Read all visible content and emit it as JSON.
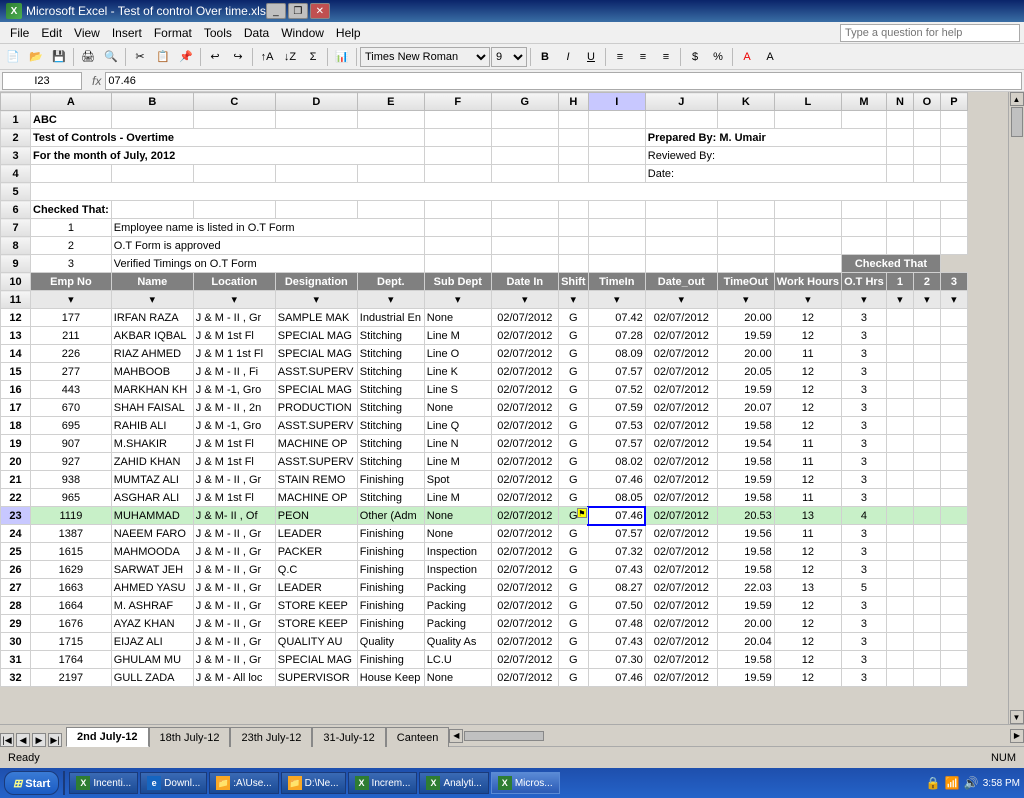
{
  "window": {
    "title": "Microsoft Excel - Test of control Over time.xls",
    "icon": "excel-icon"
  },
  "menubar": {
    "items": [
      "File",
      "Edit",
      "View",
      "Insert",
      "Format",
      "Tools",
      "Data",
      "Window",
      "Help"
    ]
  },
  "toolbar": {
    "font": "Times New Roman",
    "font_size": "9",
    "help_placeholder": "Type a question for help"
  },
  "formula_bar": {
    "name_box": "I23",
    "formula": "07.46"
  },
  "spreadsheet": {
    "title1": "ABC",
    "title2": "Test of Controls - Overtime",
    "title3": "For the month of July, 2012",
    "prepared": "Prepared By: M. Umair",
    "reviewed": "Reviewed By:",
    "date": "Date:",
    "checked_that": "Checked That:",
    "check1": "1",
    "check1_text": "Employee name is listed in O.T Form",
    "check2": "2",
    "check2_text": "O.T Form is approved",
    "check3": "3",
    "check3_text": "Verified Timings on O.T Form",
    "columns": [
      "Emp No",
      "Name",
      "Location",
      "Designation",
      "Dept.",
      "Sub Dept",
      "Date In",
      "Shift",
      "TimeIn",
      "Date_out",
      "TimeOut",
      "Work Hours",
      "O.T Hrs",
      "1",
      "2",
      "3"
    ],
    "checked_that_header": "Checked That",
    "rows": [
      [
        "177",
        "IRFAN RAZA",
        "J & M - II , Gr",
        "SAMPLE MAK",
        "Industrial En",
        "None",
        "02/07/2012",
        "G",
        "07.42",
        "02/07/2012",
        "20.00",
        "12",
        "3",
        "",
        "",
        ""
      ],
      [
        "211",
        "AKBAR IQBAL",
        "J & M 1st Fl",
        "SPECIAL MAG",
        "Stitching",
        "Line M",
        "02/07/2012",
        "G",
        "07.28",
        "02/07/2012",
        "19.59",
        "12",
        "3",
        "",
        "",
        ""
      ],
      [
        "226",
        "RIAZ AHMED",
        "J & M 1 1st Fl",
        "SPECIAL MAG",
        "Stitching",
        "Line O",
        "02/07/2012",
        "G",
        "08.09",
        "02/07/2012",
        "20.00",
        "11",
        "3",
        "",
        "",
        ""
      ],
      [
        "277",
        "MAHBOOB",
        "J & M - II , Fi",
        "ASST.SUPERV",
        "Stitching",
        "Line K",
        "02/07/2012",
        "G",
        "07.57",
        "02/07/2012",
        "20.05",
        "12",
        "3",
        "",
        "",
        ""
      ],
      [
        "443",
        "MARKHAN KH",
        "J & M -1, Gro",
        "SPECIAL MAG",
        "Stitching",
        "Line S",
        "02/07/2012",
        "G",
        "07.52",
        "02/07/2012",
        "19.59",
        "12",
        "3",
        "",
        "",
        ""
      ],
      [
        "670",
        "SHAH FAISAL",
        "J & M - II , 2n",
        "PRODUCTION",
        "Stitching",
        "None",
        "02/07/2012",
        "G",
        "07.59",
        "02/07/2012",
        "20.07",
        "12",
        "3",
        "",
        "",
        ""
      ],
      [
        "695",
        "RAHIB ALI",
        "J & M -1, Gro",
        "ASST.SUPERV",
        "Stitching",
        "Line Q",
        "02/07/2012",
        "G",
        "07.53",
        "02/07/2012",
        "19.58",
        "12",
        "3",
        "",
        "",
        ""
      ],
      [
        "907",
        "M.SHAKIR",
        "J & M 1st Fl",
        "MACHINE OP",
        "Stitching",
        "Line N",
        "02/07/2012",
        "G",
        "07.57",
        "02/07/2012",
        "19.54",
        "11",
        "3",
        "",
        "",
        ""
      ],
      [
        "927",
        "ZAHID KHAN",
        "J & M 1st Fl",
        "ASST.SUPERV",
        "Stitching",
        "Line M",
        "02/07/2012",
        "G",
        "08.02",
        "02/07/2012",
        "19.58",
        "11",
        "3",
        "",
        "",
        ""
      ],
      [
        "938",
        "MUMTAZ ALI",
        "J & M - II , Gr",
        "STAIN REMO",
        "Finishing",
        "Spot",
        "02/07/2012",
        "G",
        "07.46",
        "02/07/2012",
        "19.59",
        "12",
        "3",
        "",
        "",
        ""
      ],
      [
        "965",
        "ASGHAR ALI",
        "J & M 1st Fl",
        "MACHINE OP",
        "Stitching",
        "Line M",
        "02/07/2012",
        "G",
        "08.05",
        "02/07/2012",
        "19.58",
        "11",
        "3",
        "",
        "",
        ""
      ],
      [
        "1119",
        "MUHAMMAD",
        "J & M- II , Of",
        "PEON",
        "Other (Adm",
        "None",
        "02/07/2012",
        "G",
        "07.46",
        "02/07/2012",
        "20.53",
        "13",
        "4",
        "",
        "",
        ""
      ],
      [
        "1387",
        "NAEEM FARO",
        "J & M - II , Gr",
        "LEADER",
        "Finishing",
        "None",
        "02/07/2012",
        "G",
        "07.57",
        "02/07/2012",
        "19.56",
        "11",
        "3",
        "",
        "",
        ""
      ],
      [
        "1615",
        "MAHMOODA",
        "J & M - II , Gr",
        "PACKER",
        "Finishing",
        "Inspection",
        "02/07/2012",
        "G",
        "07.32",
        "02/07/2012",
        "19.58",
        "12",
        "3",
        "",
        "",
        ""
      ],
      [
        "1629",
        "SARWAT JEH",
        "J & M - II , Gr",
        "Q.C",
        "Finishing",
        "Inspection",
        "02/07/2012",
        "G",
        "07.43",
        "02/07/2012",
        "19.58",
        "12",
        "3",
        "",
        "",
        ""
      ],
      [
        "1663",
        "AHMED YASU",
        "J & M - II , Gr",
        "LEADER",
        "Finishing",
        "Packing",
        "02/07/2012",
        "G",
        "08.27",
        "02/07/2012",
        "22.03",
        "13",
        "5",
        "",
        "",
        ""
      ],
      [
        "1664",
        "M. ASHRAF",
        "J & M - II , Gr",
        "STORE KEEP",
        "Finishing",
        "Packing",
        "02/07/2012",
        "G",
        "07.50",
        "02/07/2012",
        "19.59",
        "12",
        "3",
        "",
        "",
        ""
      ],
      [
        "1676",
        "AYAZ KHAN",
        "J & M - II , Gr",
        "STORE KEEP",
        "Finishing",
        "Packing",
        "02/07/2012",
        "G",
        "07.48",
        "02/07/2012",
        "20.00",
        "12",
        "3",
        "",
        "",
        ""
      ],
      [
        "1715",
        "EIJAZ ALI",
        "J & M - II , Gr",
        "QUALITY AU",
        "Quality",
        "Quality As",
        "02/07/2012",
        "G",
        "07.43",
        "02/07/2012",
        "20.04",
        "12",
        "3",
        "",
        "",
        ""
      ],
      [
        "1764",
        "GHULAM MU",
        "J & M - II , Gr",
        "SPECIAL MAG",
        "Finishing",
        "LC.U",
        "02/07/2012",
        "G",
        "07.30",
        "02/07/2012",
        "19.58",
        "12",
        "3",
        "",
        "",
        ""
      ],
      [
        "2197",
        "GULL ZADA",
        "J & M - All loc",
        "SUPERVISOR",
        "House Keep",
        "None",
        "02/07/2012",
        "G",
        "07.46",
        "02/07/2012",
        "19.59",
        "12",
        "3",
        "",
        "",
        ""
      ]
    ]
  },
  "sheet_tabs": [
    "2nd July-12",
    "18th July-12",
    "23th July-12",
    "31-July-12",
    "Canteen"
  ],
  "active_tab": "2nd July-12",
  "status": {
    "text": "Ready",
    "num": "NUM"
  },
  "taskbar": {
    "start": "Start",
    "items": [
      {
        "label": "Incenti...",
        "icon": "excel"
      },
      {
        "label": "Downl...",
        "icon": "ie"
      },
      {
        "label": ":A\\Use...",
        "icon": "folder"
      },
      {
        "label": "D:\\Ne...",
        "icon": "folder"
      },
      {
        "label": "Increm...",
        "icon": "excel"
      },
      {
        "label": "Analyti...",
        "icon": "excel"
      },
      {
        "label": "Micros...",
        "icon": "excel",
        "active": true
      }
    ],
    "time": "3:58 PM"
  }
}
